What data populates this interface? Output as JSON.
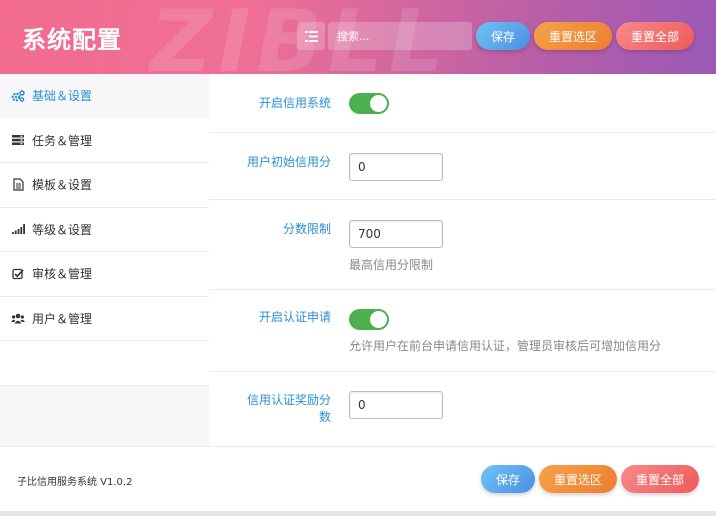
{
  "header": {
    "title": "系统配置",
    "search_placeholder": "搜索...",
    "save_label": "保存",
    "reset_selection_label": "重置选区",
    "reset_all_label": "重置全部"
  },
  "sidebar": {
    "items": [
      {
        "label": "基础＆设置",
        "icon": "gears-icon",
        "active": true
      },
      {
        "label": "任务＆管理",
        "icon": "server-icon",
        "active": false
      },
      {
        "label": "模板＆设置",
        "icon": "document-icon",
        "active": false
      },
      {
        "label": "等级＆设置",
        "icon": "signal-bars-icon",
        "active": false
      },
      {
        "label": "审核＆管理",
        "icon": "checkbox-icon",
        "active": false
      },
      {
        "label": "用户＆管理",
        "icon": "users-icon",
        "active": false
      }
    ]
  },
  "settings": {
    "enable_credit": {
      "label": "开启信用系统",
      "on": true
    },
    "initial_credit": {
      "label": "用户初始信用分",
      "value": "0"
    },
    "score_limit": {
      "label": "分数限制",
      "value": "700",
      "hint": "最高信用分限制"
    },
    "enable_certification": {
      "label": "开启认证申请",
      "on": true,
      "hint": "允许用户在前台申请信用认证，管理员审核后可增加信用分"
    },
    "cert_reward": {
      "label": "信用认证奖励分数",
      "value": "0"
    }
  },
  "footer": {
    "version": "子比信用服务系统 V1.0.2",
    "save_label": "保存",
    "reset_selection_label": "重置选区",
    "reset_all_label": "重置全部"
  },
  "colors": {
    "accent_blue": "#2a8fd6",
    "toggle_on": "#4caf50",
    "header_gradient_start": "#f26b8f",
    "header_gradient_end": "#9b59b6"
  }
}
